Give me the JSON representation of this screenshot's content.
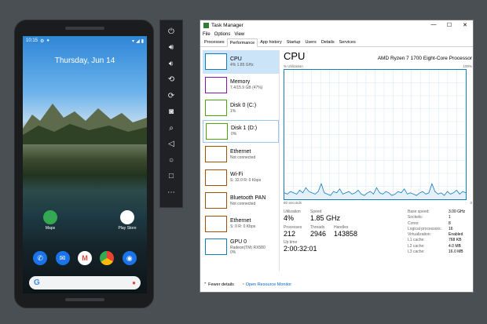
{
  "phone": {
    "status_time": "10:15",
    "date": "Thursday, Jun 14",
    "apps": [
      {
        "label": "Maps"
      },
      {
        "label": "Play Store"
      }
    ],
    "search_logo": "G"
  },
  "task_manager": {
    "title": "Task Manager",
    "menu": [
      "File",
      "Options",
      "View"
    ],
    "tabs": [
      "Processes",
      "Performance",
      "App history",
      "Startup",
      "Users",
      "Details",
      "Services"
    ],
    "active_tab": "Performance",
    "sidebar": [
      {
        "name": "CPU",
        "sub": "4% 1.85 GHz",
        "color": "#117dbb"
      },
      {
        "name": "Memory",
        "sub": "7.4/15.9 GB (47%)",
        "color": "#8b12ae"
      },
      {
        "name": "Disk 0 (C:)",
        "sub": "1%",
        "color": "#4da60c"
      },
      {
        "name": "Disk 1 (D:)",
        "sub": "0%",
        "color": "#4da60c"
      },
      {
        "name": "Ethernet",
        "sub": "Not connected",
        "color": "#a74f01"
      },
      {
        "name": "Wi-Fi",
        "sub": "S: 32.0 R: 0 Kbps",
        "color": "#a74f01"
      },
      {
        "name": "Bluetooth PAN",
        "sub": "Not connected",
        "color": "#a74f01"
      },
      {
        "name": "Ethernet",
        "sub": "S: 0 R: 0 Kbps",
        "color": "#a74f01"
      },
      {
        "name": "GPU 0",
        "sub": "Radeon(TM) RX580",
        "sub2": "0%",
        "color": "#117dbb"
      }
    ],
    "main": {
      "heading": "CPU",
      "cpu_name": "AMD Ryzen 7 1700 Eight-Core Processor",
      "util_label": "% Utilization",
      "util_max": "100%",
      "time_label": "60 seconds",
      "zero": "0",
      "stats": [
        {
          "label": "Utilization",
          "value": "4%"
        },
        {
          "label": "Speed",
          "value": "1.85 GHz"
        },
        {
          "label": "Processes",
          "value": "212"
        },
        {
          "label": "Threads",
          "value": "2946"
        },
        {
          "label": "Handles",
          "value": "143858"
        },
        {
          "label": "Up time",
          "value": "2:00:32:01"
        }
      ],
      "details": [
        {
          "k": "Base speed:",
          "v": "3.00 GHz"
        },
        {
          "k": "Sockets:",
          "v": "1"
        },
        {
          "k": "Cores:",
          "v": "8"
        },
        {
          "k": "Logical processors:",
          "v": "16"
        },
        {
          "k": "Virtualization:",
          "v": "Enabled"
        },
        {
          "k": "L1 cache:",
          "v": "768 KB"
        },
        {
          "k": "L2 cache:",
          "v": "4.0 MB"
        },
        {
          "k": "L3 cache:",
          "v": "16.0 MB"
        }
      ],
      "cpu_history": [
        5,
        4,
        6,
        5,
        4,
        7,
        5,
        9,
        6,
        5,
        4,
        6,
        12,
        5,
        4,
        3,
        6,
        5,
        8,
        4,
        5,
        6,
        4,
        5,
        7,
        4,
        3,
        5,
        6,
        4,
        9,
        5,
        4,
        6,
        5,
        3,
        4,
        6,
        5,
        8,
        4,
        5,
        4,
        3,
        5,
        6,
        4,
        5,
        12,
        6,
        4,
        5,
        3,
        6,
        4,
        5,
        7,
        4,
        6,
        5
      ]
    },
    "footer": {
      "fewer": "Fewer details",
      "monitor": "Open Resource Monitor"
    }
  },
  "colors": {
    "accent": "#117dbb",
    "selected": "#cce4f7"
  }
}
